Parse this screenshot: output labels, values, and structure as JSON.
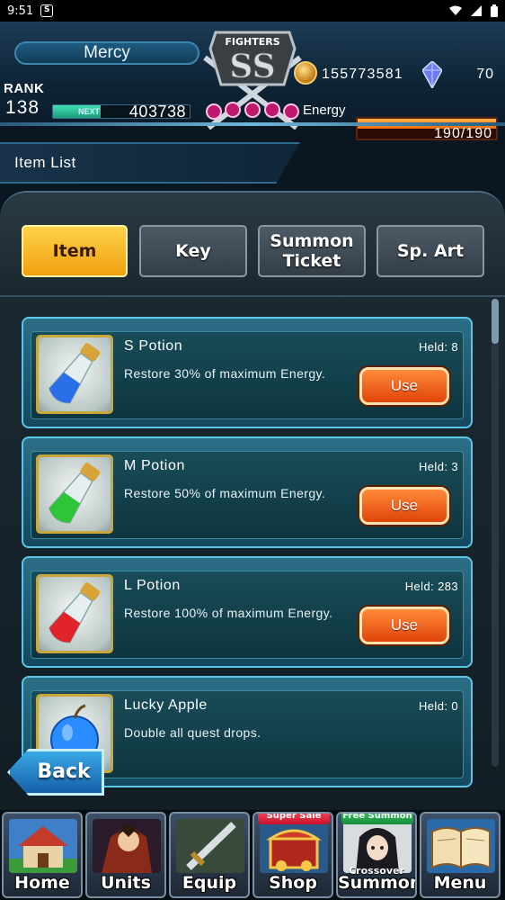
{
  "status_bar": {
    "time": "9:51"
  },
  "player": {
    "name": "Mercy",
    "rank_label": "RANK",
    "rank": "138",
    "next_label": "NEXT",
    "exp_to_next": "403738",
    "exp_progress": 0.35
  },
  "emblem": {
    "label": "FIGHTERS",
    "grade": "SS"
  },
  "currency": {
    "coins": "155773581",
    "gems": "70"
  },
  "energy": {
    "label": "Energy",
    "value": "190/190",
    "fraction": 1.0
  },
  "page": {
    "title": "Item List"
  },
  "tabs": [
    {
      "label": "Item",
      "active": true
    },
    {
      "label": "Key",
      "active": false
    },
    {
      "label": "Summon\nTicket",
      "active": false
    },
    {
      "label": "Sp. Art",
      "active": false
    }
  ],
  "items": [
    {
      "name": "S Potion",
      "held": "Held: 8",
      "description": "Restore 30% of maximum Energy.",
      "use_label": "Use",
      "liquid_color": "#2a6ee8"
    },
    {
      "name": "M Potion",
      "held": "Held: 3",
      "description": "Restore 50% of maximum Energy.",
      "use_label": "Use",
      "liquid_color": "#2fc43a"
    },
    {
      "name": "L Potion",
      "held": "Held: 283",
      "description": "Restore 100% of maximum Energy.",
      "use_label": "Use",
      "liquid_color": "#e0242a"
    },
    {
      "name": "Lucky Apple",
      "held": "Held: 0",
      "description": "Double all quest drops.",
      "use_label": "",
      "liquid_color": "#2a8cff"
    }
  ],
  "back_label": "Back",
  "bottom_nav": [
    {
      "label": "Home",
      "badge": ""
    },
    {
      "label": "Units",
      "badge": ""
    },
    {
      "label": "Equip",
      "badge": ""
    },
    {
      "label": "Shop",
      "badge": "Super Sale"
    },
    {
      "label": "Summon",
      "badge": "Free Summon",
      "extra": "Crossover"
    },
    {
      "label": "Menu",
      "badge": ""
    }
  ]
}
